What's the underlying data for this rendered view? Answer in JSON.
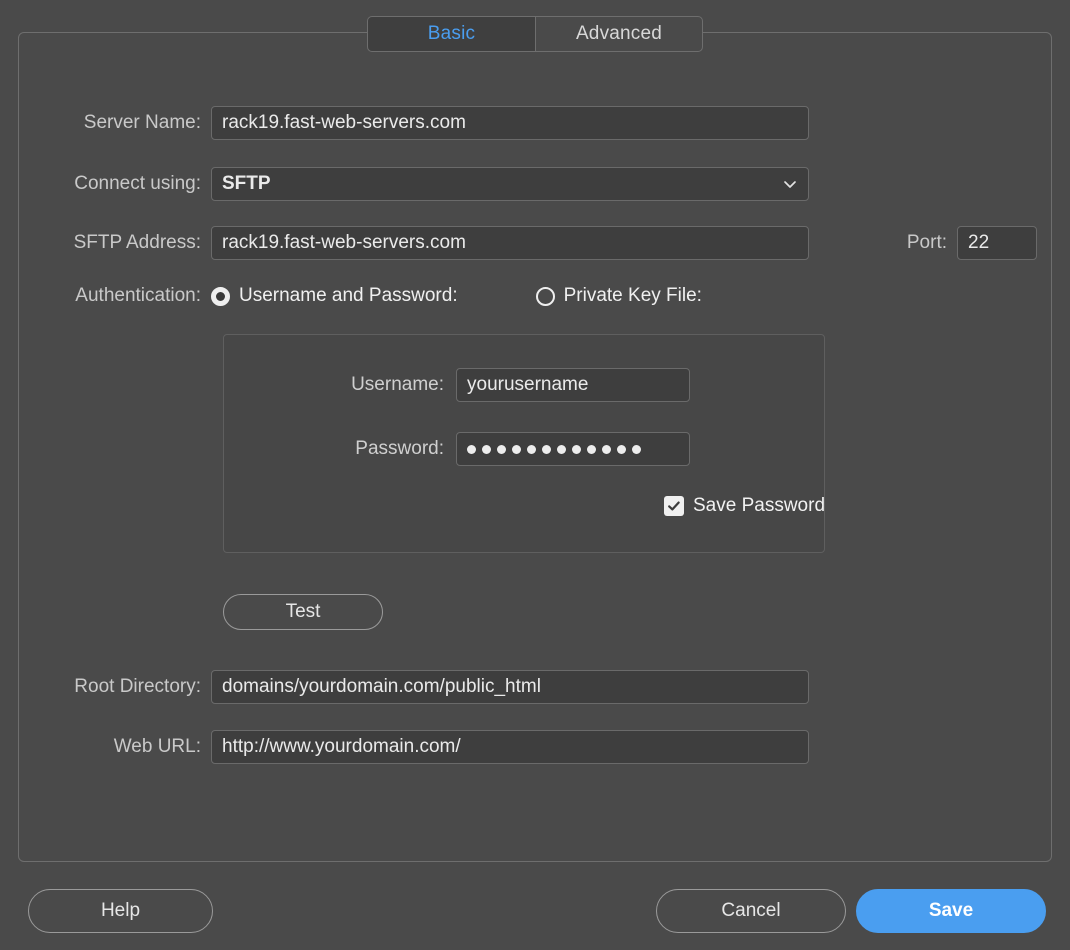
{
  "tabs": [
    {
      "label": "Basic",
      "active": true
    },
    {
      "label": "Advanced",
      "active": false
    }
  ],
  "form": {
    "server_name": {
      "label": "Server Name:",
      "value": "rack19.fast-web-servers.com"
    },
    "connect_using": {
      "label": "Connect using:",
      "value": "SFTP",
      "icon": "chevron-down-icon"
    },
    "sftp_address": {
      "label": "SFTP Address:",
      "value": "rack19.fast-web-servers.com"
    },
    "port": {
      "label": "Port:",
      "value": "22"
    },
    "authentication": {
      "label": "Authentication:",
      "options": [
        {
          "label": "Username and Password:",
          "selected": true
        },
        {
          "label": "Private Key File:",
          "selected": false
        }
      ]
    },
    "credentials": {
      "username": {
        "label": "Username:",
        "value": "yourusername"
      },
      "password": {
        "label": "Password:",
        "masked_length": 12
      },
      "save_password": {
        "label": "Save Password",
        "checked": true
      }
    },
    "test_button": {
      "label": "Test"
    },
    "root_directory": {
      "label": "Root Directory:",
      "value": "domains/yourdomain.com/public_html"
    },
    "web_url": {
      "label": "Web URL:",
      "value": "http://www.yourdomain.com/"
    }
  },
  "footer": {
    "help_label": "Help",
    "cancel_label": "Cancel",
    "save_label": "Save"
  },
  "colors": {
    "window_background": "#4a4a4a",
    "field_background": "#3e3e3e",
    "accent_blue": "#4a9ef0",
    "border": "#6e6e6e",
    "label_text": "#c9c9c9",
    "value_text": "#eaeaea"
  }
}
